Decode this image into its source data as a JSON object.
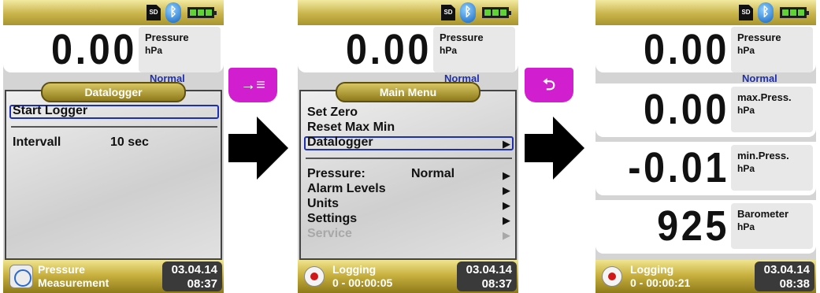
{
  "status": {
    "sd_label": "SD",
    "bluetooth": "bluetooth-icon",
    "battery": "battery-icon"
  },
  "screen1": {
    "value": "0.00",
    "quantity": "Pressure",
    "unit": "hPa",
    "mode": "Normal",
    "menu_title": "Datalogger",
    "items": [
      {
        "label": "Start Logger"
      }
    ],
    "interval_label": "Intervall",
    "interval_value": "10 sec",
    "footer_line1": "Pressure",
    "footer_line2": "Measurement",
    "date": "03.04.14",
    "time": "08:37"
  },
  "screen2": {
    "value": "0.00",
    "quantity": "Pressure",
    "unit": "hPa",
    "mode": "Normal",
    "menu_title": "Main Menu",
    "items": [
      {
        "label": "Set Zero"
      },
      {
        "label": "Reset Max Min"
      },
      {
        "label": "Datalogger",
        "arrow": "▶"
      },
      {
        "label": "Pressure:",
        "value": "Normal",
        "arrow": "▶"
      },
      {
        "label": "Alarm Levels",
        "arrow": "▶"
      },
      {
        "label": "Units",
        "arrow": "▶"
      },
      {
        "label": "Settings",
        "arrow": "▶"
      },
      {
        "label": "Service",
        "arrow": "▶"
      }
    ],
    "footer_line1": "Logging",
    "footer_line2": "0 - 00:00:05",
    "date": "03.04.14",
    "time": "08:37"
  },
  "screen3": {
    "readings": [
      {
        "value": "0.00",
        "quantity": "Pressure",
        "unit": "hPa",
        "mode": "Normal"
      },
      {
        "value": "0.00",
        "quantity": "max.Press.",
        "unit": "hPa"
      },
      {
        "value": "-0.01",
        "quantity": "min.Press.",
        "unit": "hPa"
      },
      {
        "value": "925",
        "quantity": "Barometer",
        "unit": "hPa"
      }
    ],
    "footer_line1": "Logging",
    "footer_line2": "0 - 00:00:21",
    "date": "03.04.14",
    "time": "08:38"
  },
  "keys": {
    "enter_symbol": "→≡",
    "back_symbol": "⮌"
  },
  "colors": {
    "key": "#d11fcf",
    "selection": "#1e2fb0",
    "header_gold": "#c8b44a"
  }
}
